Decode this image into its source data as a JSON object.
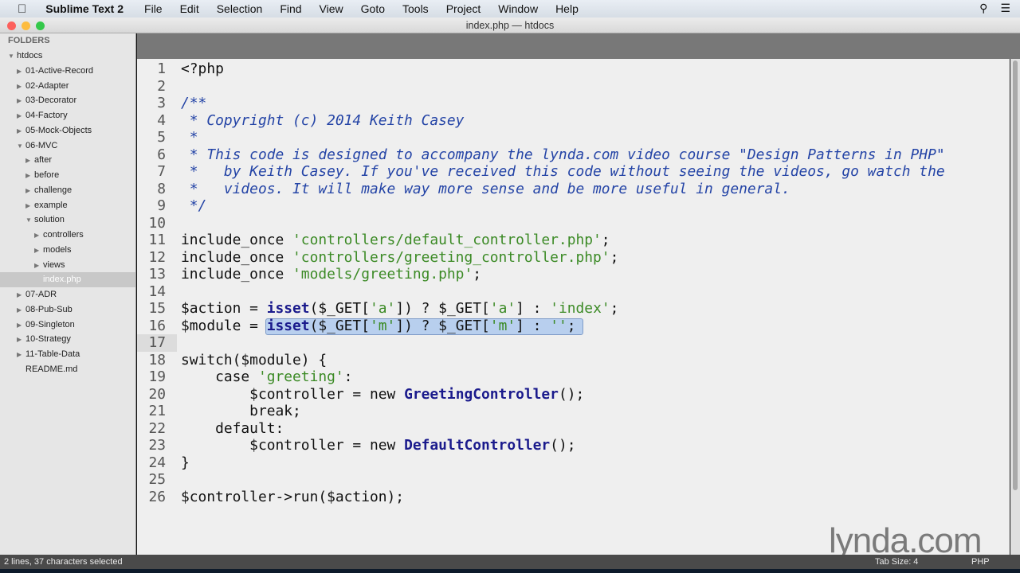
{
  "menubar": {
    "app": "Sublime Text 2",
    "items": [
      "File",
      "Edit",
      "Selection",
      "Find",
      "View",
      "Goto",
      "Tools",
      "Project",
      "Window",
      "Help"
    ]
  },
  "window": {
    "title": "index.php — htdocs"
  },
  "sidebar": {
    "header": "FOLDERS",
    "items": [
      {
        "label": "htdocs",
        "depth": 0,
        "open": true
      },
      {
        "label": "01-Active-Record",
        "depth": 1
      },
      {
        "label": "02-Adapter",
        "depth": 1
      },
      {
        "label": "03-Decorator",
        "depth": 1
      },
      {
        "label": "04-Factory",
        "depth": 1
      },
      {
        "label": "05-Mock-Objects",
        "depth": 1
      },
      {
        "label": "06-MVC",
        "depth": 1,
        "open": true
      },
      {
        "label": "after",
        "depth": 2
      },
      {
        "label": "before",
        "depth": 2
      },
      {
        "label": "challenge",
        "depth": 2
      },
      {
        "label": "example",
        "depth": 2
      },
      {
        "label": "solution",
        "depth": 2,
        "open": true
      },
      {
        "label": "controllers",
        "depth": 3
      },
      {
        "label": "models",
        "depth": 3
      },
      {
        "label": "views",
        "depth": 3
      },
      {
        "label": "index.php",
        "depth": 3,
        "file": true,
        "selected": true
      },
      {
        "label": "07-ADR",
        "depth": 1
      },
      {
        "label": "08-Pub-Sub",
        "depth": 1
      },
      {
        "label": "09-Singleton",
        "depth": 1
      },
      {
        "label": "10-Strategy",
        "depth": 1
      },
      {
        "label": "11-Table-Data",
        "depth": 1
      },
      {
        "label": "README.md",
        "depth": 1,
        "file": true
      }
    ]
  },
  "editor": {
    "current_line": 17,
    "lines": [
      [
        [
          "<?php",
          ""
        ]
      ],
      [],
      [
        [
          "/**",
          "c"
        ]
      ],
      [
        [
          " * Copyright (c) 2014 Keith Casey",
          "c"
        ]
      ],
      [
        [
          " *",
          "c"
        ]
      ],
      [
        [
          " * This code is designed to accompany the lynda.com video course \"Design Patterns in PHP\"",
          "c"
        ]
      ],
      [
        [
          " *   by Keith Casey. If you've received this code without seeing the videos, go watch the",
          "c"
        ]
      ],
      [
        [
          " *   videos. It will make way more sense and be more useful in general.",
          "c"
        ]
      ],
      [
        [
          " */",
          "c"
        ]
      ],
      [],
      [
        [
          "include_once ",
          ""
        ],
        [
          "'controllers/default_controller.php'",
          "s"
        ],
        [
          ";",
          ""
        ]
      ],
      [
        [
          "include_once ",
          ""
        ],
        [
          "'controllers/greeting_controller.php'",
          "s"
        ],
        [
          ";",
          ""
        ]
      ],
      [
        [
          "include_once ",
          ""
        ],
        [
          "'models/greeting.php'",
          "s"
        ],
        [
          ";",
          ""
        ]
      ],
      [],
      [
        [
          "$action = ",
          ""
        ],
        [
          "isset",
          "k"
        ],
        [
          "($_GET[",
          ""
        ],
        [
          "'a'",
          "s"
        ],
        [
          "]) ? $_GET[",
          ""
        ],
        [
          "'a'",
          "s"
        ],
        [
          "] : ",
          ""
        ],
        [
          "'index'",
          "s"
        ],
        [
          ";",
          ""
        ]
      ],
      [
        [
          "$module = ",
          ""
        ],
        [
          "isset",
          "k"
        ],
        [
          "($_GET[",
          ""
        ],
        [
          "'m'",
          "s"
        ],
        [
          "]) ? $_GET[",
          ""
        ],
        [
          "'m'",
          "s"
        ],
        [
          "] : ",
          ""
        ],
        [
          "''",
          "s"
        ],
        [
          ";",
          ""
        ]
      ],
      [],
      [
        [
          "switch($module) {",
          ""
        ]
      ],
      [
        [
          "    case ",
          ""
        ],
        [
          "'greeting'",
          "s"
        ],
        [
          ":",
          ""
        ]
      ],
      [
        [
          "        $controller = new ",
          ""
        ],
        [
          "GreetingController",
          "k"
        ],
        [
          "();",
          ""
        ]
      ],
      [
        [
          "        break;",
          ""
        ]
      ],
      [
        [
          "    default:",
          ""
        ]
      ],
      [
        [
          "        $controller = new ",
          ""
        ],
        [
          "DefaultController",
          "k"
        ],
        [
          "();",
          ""
        ]
      ],
      [
        [
          "}",
          ""
        ]
      ],
      [],
      [
        [
          "$controller->run($action);",
          ""
        ]
      ]
    ]
  },
  "status": {
    "selection": "2 lines, 37 characters selected",
    "tab_size": "Tab Size: 4",
    "syntax": "PHP"
  },
  "watermark": "lynda.com"
}
